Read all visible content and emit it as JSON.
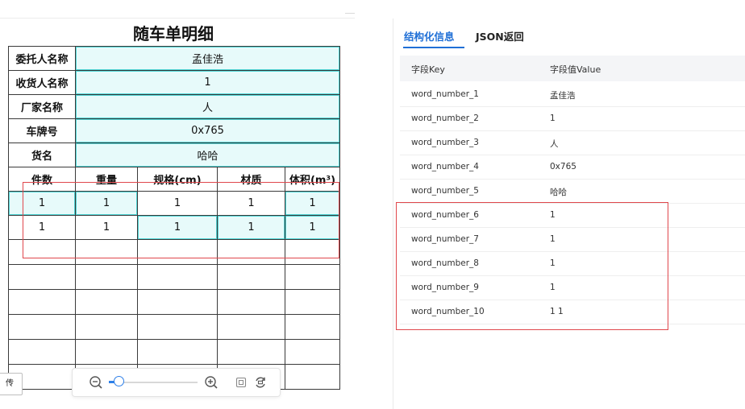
{
  "document": {
    "title": "随车单明细",
    "info_rows": [
      {
        "label": "委托人名称",
        "value": "孟佳浩"
      },
      {
        "label": "收货人名称",
        "value": "1"
      },
      {
        "label": "厂家名称",
        "value": "人"
      },
      {
        "label": "车牌号",
        "value": "0x765"
      },
      {
        "label": "货名",
        "value": "哈哈"
      }
    ],
    "columns": [
      "件数",
      "重量",
      "规格(cm)",
      "材质",
      "体积(m³)"
    ],
    "data_rows": [
      [
        "1",
        "1",
        "1",
        "1",
        "1"
      ],
      [
        "1",
        "1",
        "1",
        "1",
        "1"
      ]
    ],
    "side_chip": "传"
  },
  "result": {
    "tabs": [
      "结构化信息",
      "JSON返回"
    ],
    "active_tab": "结构化信息",
    "header": {
      "key": "字段Key",
      "value": "字段值Value"
    },
    "rows": [
      {
        "key": "word_number_1",
        "value": "孟佳浩"
      },
      {
        "key": "word_number_2",
        "value": "1"
      },
      {
        "key": "word_number_3",
        "value": "人"
      },
      {
        "key": "word_number_4",
        "value": "0x765"
      },
      {
        "key": "word_number_5",
        "value": "哈哈"
      },
      {
        "key": "word_number_6",
        "value": "1"
      },
      {
        "key": "word_number_7",
        "value": "1"
      },
      {
        "key": "word_number_8",
        "value": "1"
      },
      {
        "key": "word_number_9",
        "value": "1"
      },
      {
        "key": "word_number_10",
        "value": "1 1"
      }
    ]
  },
  "colors": {
    "accent": "#1f6fd6",
    "highlight_box": "#e0474c",
    "cell_highlight": "#e7fafa",
    "cell_highlight_border": "#4fd6d6"
  },
  "icons": [
    "zoom-out-icon",
    "zoom-in-icon",
    "fit-page-icon",
    "rotate-icon"
  ]
}
